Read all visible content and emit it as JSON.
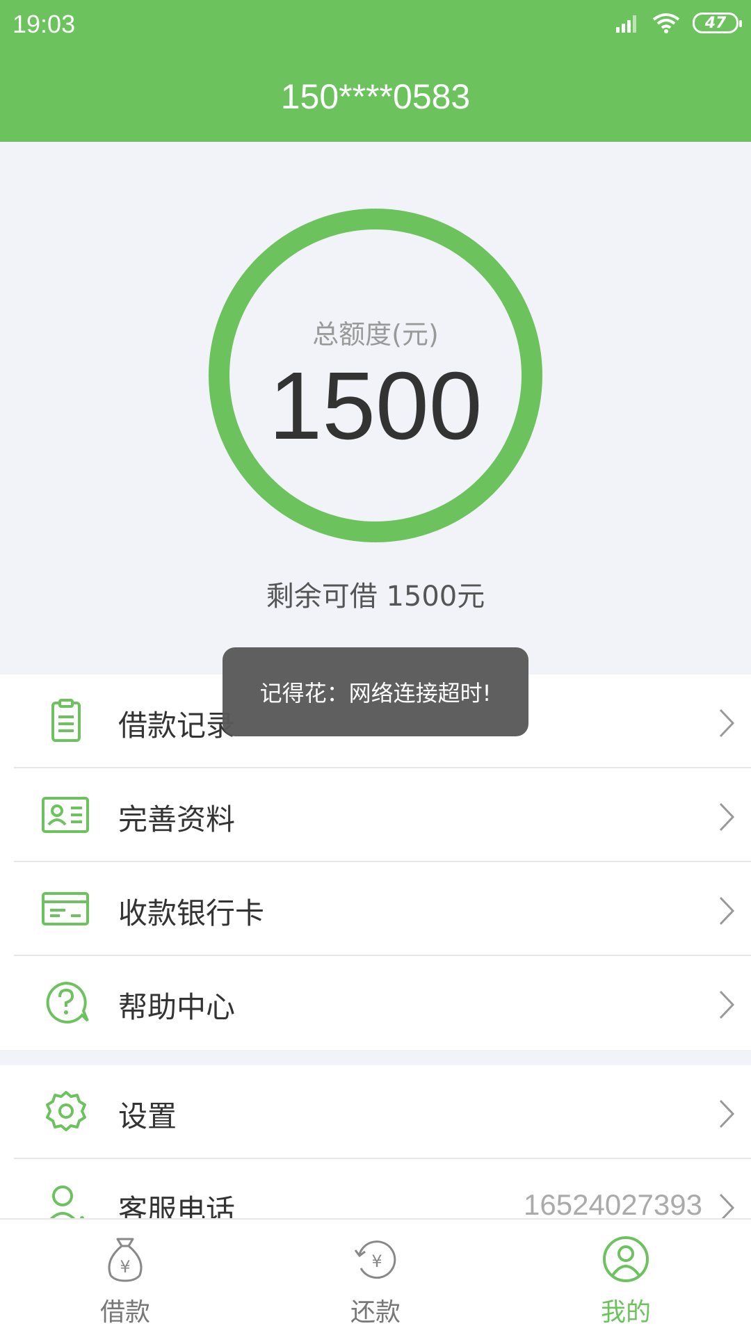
{
  "status_bar": {
    "time": "19:03",
    "battery": "47"
  },
  "header": {
    "title": "150****0583"
  },
  "credit": {
    "label": "总额度(元)",
    "value": "1500",
    "remaining": "剩余可借 1500元"
  },
  "menu": {
    "items": [
      {
        "label": "借款记录",
        "icon": "clipboard-icon"
      },
      {
        "label": "完善资料",
        "icon": "id-card-icon"
      },
      {
        "label": "收款银行卡",
        "icon": "bank-card-icon"
      },
      {
        "label": "帮助中心",
        "icon": "help-icon"
      }
    ],
    "settings": {
      "label": "设置",
      "icon": "gear-icon"
    },
    "service": {
      "label": "客服电话",
      "value": "16524027393",
      "icon": "user-icon"
    }
  },
  "toast": {
    "text": "记得花：网络连接超时!"
  },
  "tabs": [
    {
      "label": "借款",
      "icon": "money-bag-icon",
      "active": false
    },
    {
      "label": "还款",
      "icon": "repay-icon",
      "active": false
    },
    {
      "label": "我的",
      "icon": "user-icon",
      "active": true
    }
  ],
  "colors": {
    "accent": "#6cc35e",
    "background": "#f2f3f8",
    "toast": "#585858"
  }
}
